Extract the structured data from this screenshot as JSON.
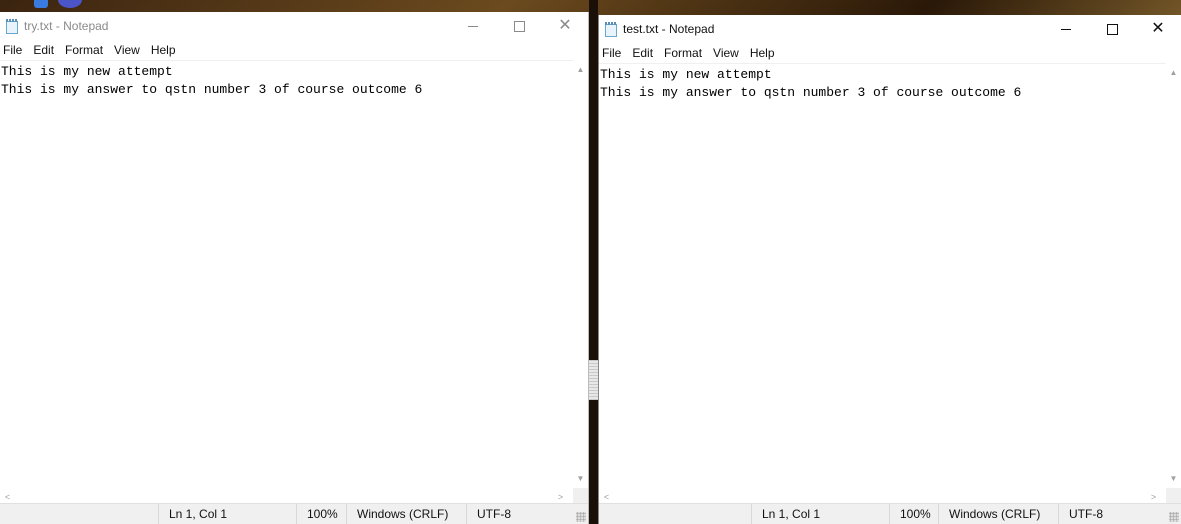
{
  "desktop": {
    "icon_a": "app-icon",
    "icon_b": "chrome-icon"
  },
  "windows": [
    {
      "title": "try.txt - Notepad",
      "menu": [
        "File",
        "Edit",
        "Format",
        "View",
        "Help"
      ],
      "lines": [
        "This is my new attempt",
        "This is my answer to qstn number 3 of course outcome 6"
      ],
      "status": {
        "position": "Ln 1, Col 1",
        "zoom": "100%",
        "line_ending": "Windows (CRLF)",
        "encoding": "UTF-8"
      }
    },
    {
      "title": "test.txt - Notepad",
      "menu": [
        "File",
        "Edit",
        "Format",
        "View",
        "Help"
      ],
      "lines": [
        "This is my new attempt",
        "This is my answer to qstn number 3 of course outcome 6"
      ],
      "status": {
        "position": "Ln 1, Col 1",
        "zoom": "100%",
        "line_ending": "Windows (CRLF)",
        "encoding": "UTF-8"
      }
    }
  ],
  "caption_icons": [
    "minimize-icon",
    "maximize-icon",
    "close-icon"
  ],
  "colors": {
    "inactive_title": "#8a8a8a",
    "active_title": "#111111",
    "status_bg": "#f0f0f0"
  }
}
